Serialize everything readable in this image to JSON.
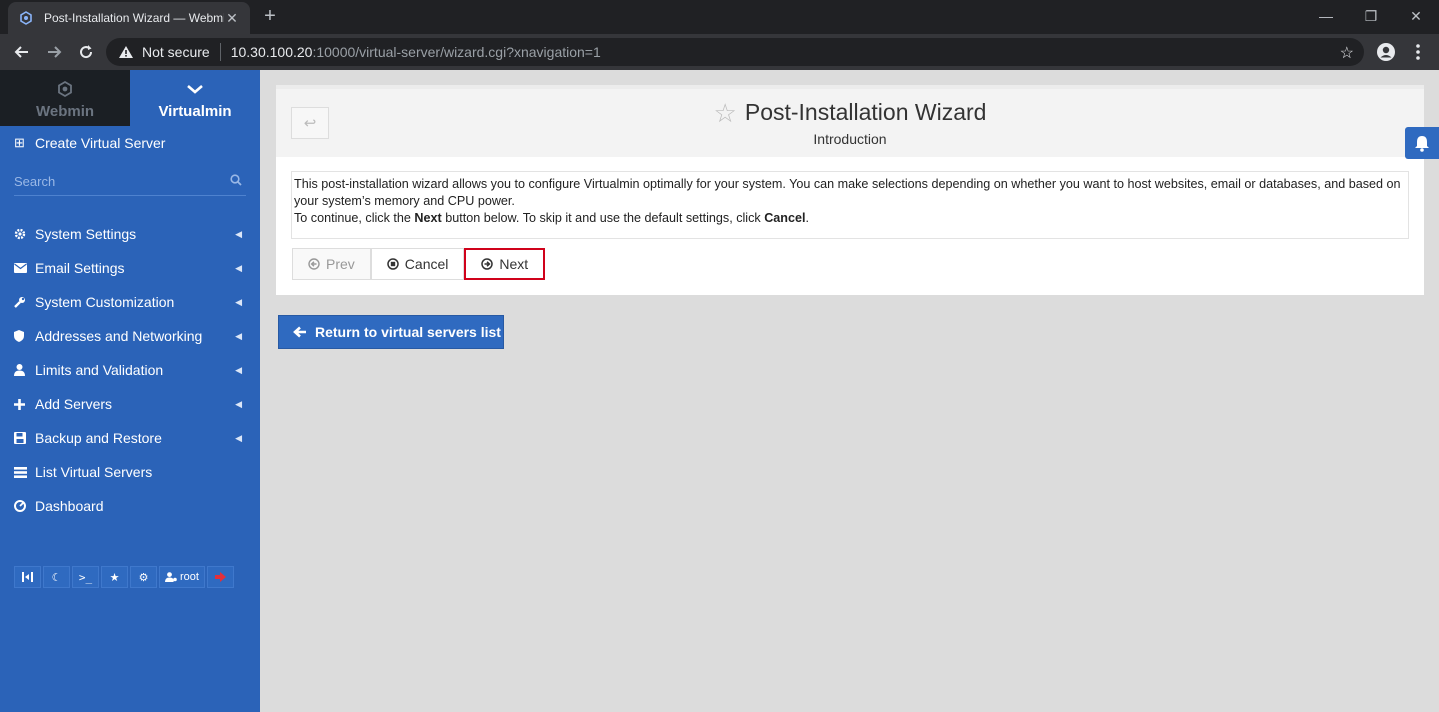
{
  "browser": {
    "tab_title": "Post-Installation Wizard — Webmin",
    "security_label": "Not secure",
    "url_host": "10.30.100.20",
    "url_path": ":10000/virtual-server/wizard.cgi?xnavigation=1"
  },
  "sidebar": {
    "tabs": [
      {
        "label": "Webmin",
        "icon": "webmin-logo-icon"
      },
      {
        "label": "Virtualmin",
        "icon": "chevron-down-icon"
      }
    ],
    "create_label": "Create Virtual Server",
    "search_placeholder": "Search",
    "items": [
      {
        "label": "System Settings",
        "icon": "gear-icon",
        "expandable": true
      },
      {
        "label": "Email Settings",
        "icon": "envelope-icon",
        "expandable": true
      },
      {
        "label": "System Customization",
        "icon": "wrench-icon",
        "expandable": true
      },
      {
        "label": "Addresses and Networking",
        "icon": "shield-icon",
        "expandable": true
      },
      {
        "label": "Limits and Validation",
        "icon": "user-icon",
        "expandable": true
      },
      {
        "label": "Add Servers",
        "icon": "plus-icon",
        "expandable": true
      },
      {
        "label": "Backup and Restore",
        "icon": "floppy-icon",
        "expandable": true
      },
      {
        "label": "List Virtual Servers",
        "icon": "list-icon",
        "expandable": false
      },
      {
        "label": "Dashboard",
        "icon": "dashboard-icon",
        "expandable": false
      }
    ],
    "footer": {
      "user_label": "root"
    }
  },
  "main": {
    "title": "Post-Installation Wizard",
    "subtitle": "Introduction",
    "desc_line1": "This post-installation wizard allows you to configure Virtualmin optimally for your system. You can make selections depending on whether you want to host websites, email or databases, and based on your system’s memory and CPU power.",
    "desc_line2_pre": "To continue, click the ",
    "desc_line2_next": "Next",
    "desc_line2_mid": " button below. To skip it and use the default settings, click ",
    "desc_line2_cancel": "Cancel",
    "desc_line2_end": ".",
    "buttons": {
      "prev": "Prev",
      "cancel": "Cancel",
      "next": "Next"
    },
    "return_label": "Return to virtual servers list"
  },
  "colors": {
    "sidebar": "#2b63b8",
    "highlight": "#d0021b",
    "button_blue": "#2f6ac0"
  }
}
